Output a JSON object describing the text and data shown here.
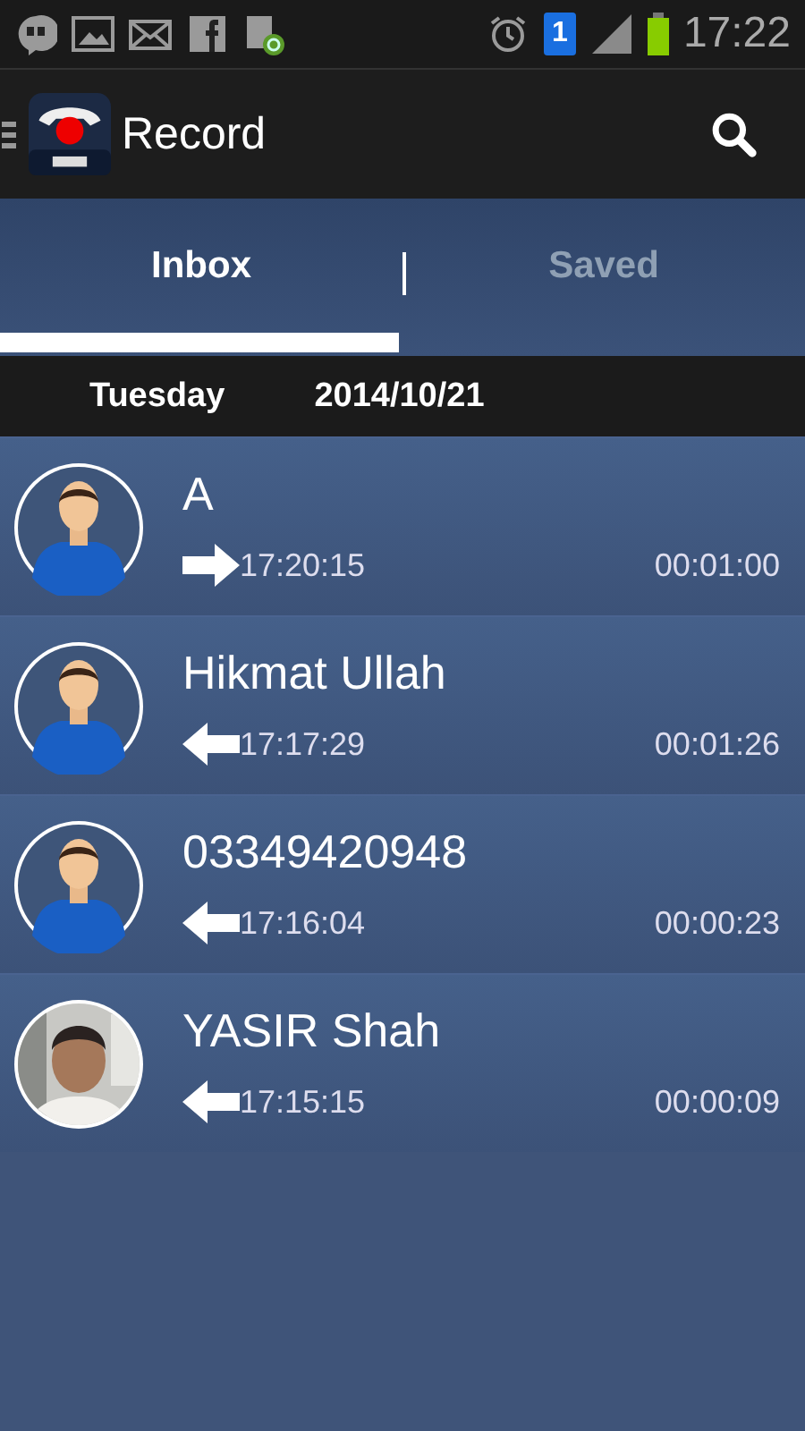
{
  "status_bar": {
    "badge": "1",
    "time": "17:22"
  },
  "app_bar": {
    "title": "Record"
  },
  "tabs": [
    {
      "label": "Inbox",
      "selected": true
    },
    {
      "label": "Saved",
      "selected": false
    }
  ],
  "date_header": {
    "day": "Tuesday",
    "date": "2014/10/21"
  },
  "calls": [
    {
      "name": "A",
      "kind": "default",
      "outgoing": true,
      "time": "17:20:15",
      "duration": "00:01:00"
    },
    {
      "name": "Hikmat Ullah",
      "kind": "default",
      "outgoing": false,
      "time": "17:17:29",
      "duration": "00:01:26"
    },
    {
      "name": "03349420948",
      "kind": "default",
      "outgoing": false,
      "time": "17:16:04",
      "duration": "00:00:23"
    },
    {
      "name": "YASIR Shah",
      "kind": "picture",
      "outgoing": false,
      "time": "17:15:15",
      "duration": "00:00:09"
    }
  ]
}
